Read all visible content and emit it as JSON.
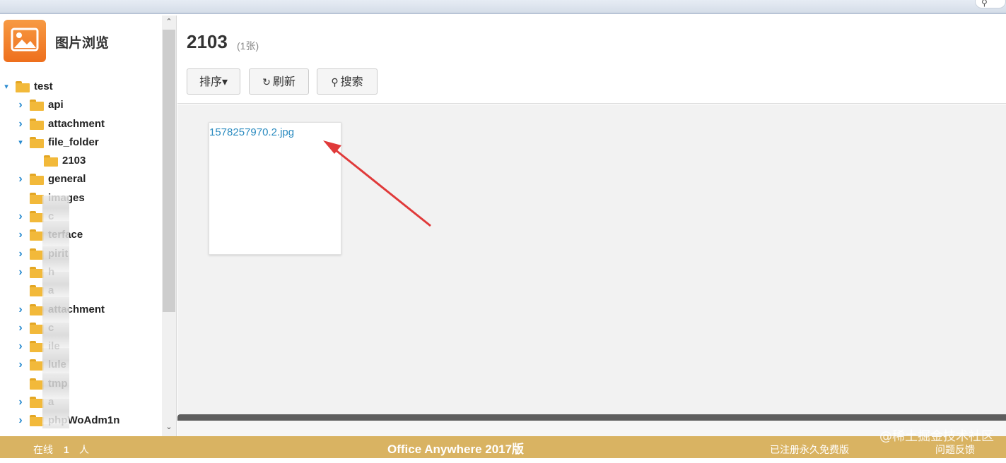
{
  "top_bar": {
    "search_icon": "search-icon"
  },
  "sidebar": {
    "app_title": "图片浏览",
    "tree": [
      {
        "label": "test",
        "level": 0,
        "expanded": true
      },
      {
        "label": "api",
        "level": 1,
        "expanded": false
      },
      {
        "label": "attachment",
        "level": 1,
        "expanded": false
      },
      {
        "label": "file_folder",
        "level": 1,
        "expanded": true
      },
      {
        "label": "2103",
        "level": 2,
        "expanded": null
      },
      {
        "label": "general",
        "level": 1,
        "expanded": false
      },
      {
        "label": "images",
        "level": 1,
        "expanded": null
      },
      {
        "label": "c",
        "level": 1,
        "expanded": false
      },
      {
        "label": "terface",
        "level": 1,
        "expanded": false
      },
      {
        "label": "pirit",
        "level": 1,
        "expanded": false
      },
      {
        "label": "h",
        "level": 1,
        "expanded": false
      },
      {
        "label": "a",
        "level": 1,
        "expanded": null
      },
      {
        "label": "attachment",
        "level": 1,
        "expanded": false
      },
      {
        "label": "c",
        "level": 1,
        "expanded": false
      },
      {
        "label": "ile",
        "level": 1,
        "expanded": false
      },
      {
        "label": "lule",
        "level": 1,
        "expanded": false
      },
      {
        "label": "tmp",
        "level": 1,
        "expanded": null
      },
      {
        "label": "a",
        "level": 1,
        "expanded": false
      },
      {
        "label": "phpWoAdm1n",
        "level": 1,
        "expanded": false
      }
    ]
  },
  "main": {
    "folder_title": "2103",
    "count": "(1张)",
    "toolbar": {
      "sort_label": "排序▾",
      "refresh_label": "刷新",
      "search_label": "搜索"
    },
    "files": [
      {
        "name": "1578257970.2.jpg"
      }
    ]
  },
  "footer": {
    "online_label": "在线",
    "online_count": "1",
    "online_unit": "人",
    "brand": "Office Anywhere 2017版",
    "license": "已注册永久免费版",
    "feedback": "问题反馈"
  },
  "watermark": "@稀土掘金技术社区",
  "colors": {
    "accent_blue": "#2b8bc0",
    "footer_gold": "#d9b362",
    "logo_orange": "#ee6f1d",
    "folder_yellow": "#f2b93a",
    "annotation_red": "#e03a3a"
  }
}
